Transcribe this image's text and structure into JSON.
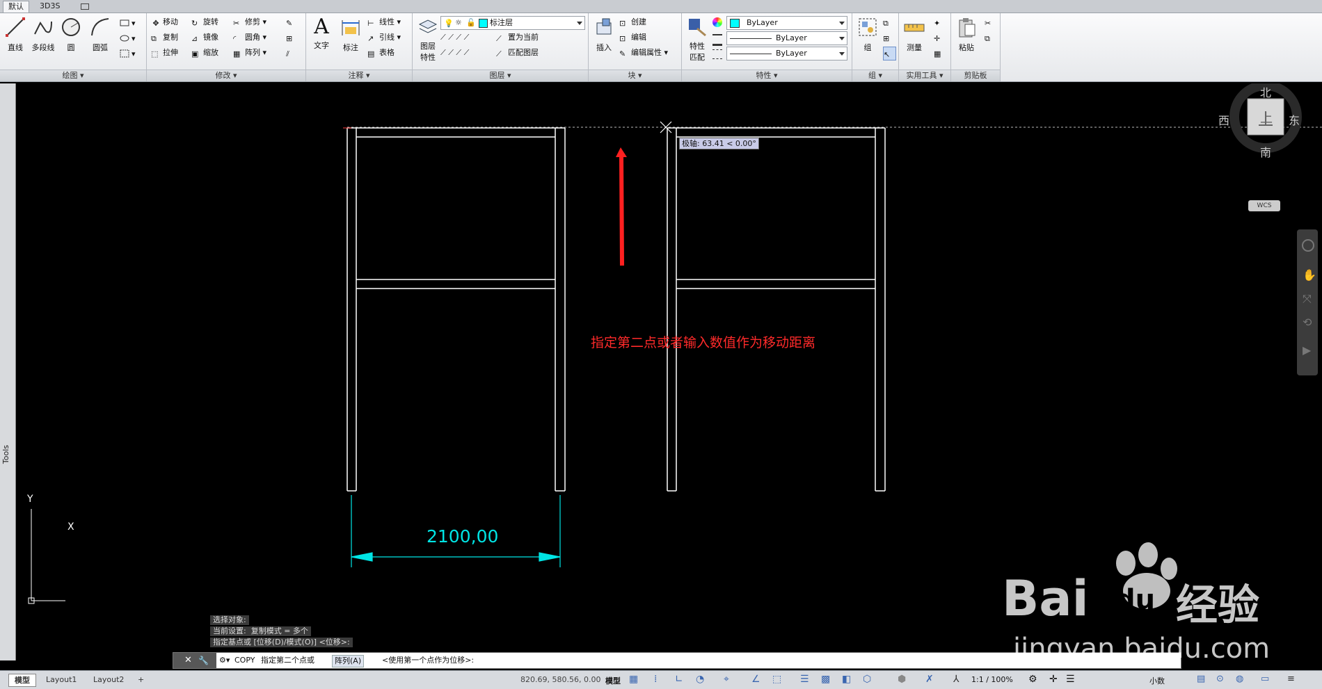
{
  "tabs": [
    "默认",
    "3D3S"
  ],
  "panels": {
    "draw": {
      "title": "绘图",
      "line": "直线",
      "polyline": "多段线",
      "circle": "圆",
      "arc": "圆弧"
    },
    "modify": {
      "title": "修改",
      "move": "移动",
      "copy": "复制",
      "stretch": "拉伸",
      "rotate": "旋转",
      "mirror": "镜像",
      "scale": "缩放",
      "trim": "修剪",
      "fillet": "圆角",
      "array": "阵列"
    },
    "annotation": {
      "title": "注释",
      "text": "文字",
      "dimension": "标注",
      "linear": "线性",
      "leader": "引线",
      "table": "表格"
    },
    "layers": {
      "title": "图层",
      "props": "图层\n特性",
      "props_l1": "图层",
      "props_l2": "特性",
      "layer_name": "标注层",
      "set_current": "置为当前",
      "match_layer": "匹配图层"
    },
    "block": {
      "title": "块",
      "insert": "插入",
      "create": "创建",
      "edit": "编辑",
      "edit_attr": "编辑属性"
    },
    "properties": {
      "title": "特性",
      "match_l1": "特性",
      "match_l2": "匹配",
      "color": "ByLayer",
      "linetype": "ByLayer",
      "lineweight": "ByLayer"
    },
    "group": {
      "title": "组",
      "group": "组"
    },
    "utilities": {
      "title": "实用工具",
      "measure": "测量"
    },
    "clipboard": {
      "title": "剪贴板",
      "paste": "粘贴"
    }
  },
  "left_strip": {
    "label": "Tools"
  },
  "tooltip": {
    "text": "极轴: 63.41 < 0.00°"
  },
  "annotation_text": "指定第二点或者输入数值作为移动距离",
  "dimension_value": "2100,00",
  "compass": {
    "north": "北",
    "south": "南",
    "east": "东",
    "west": "西",
    "top": "上",
    "wcs": "WCS"
  },
  "ucs": {
    "x": "X",
    "y": "Y"
  },
  "command_history": [
    "选择对象:",
    "当前设置:  复制模式 = 多个",
    "指定基点或 [位移(D)/模式(O)] <位移>:"
  ],
  "command_line": {
    "command": "COPY",
    "prompt": "指定第二个点或",
    "option": "阵列(A)",
    "default": "<使用第一个点作为位移>:"
  },
  "status": {
    "tabs": [
      "模型",
      "Layout1",
      "Layout2"
    ],
    "coords": "820.69, 580.56, 0.00",
    "model": "模型",
    "scale": "1:1 / 100%",
    "units": "小数"
  },
  "watermark": {
    "brand": "Bai",
    "brand2": "du",
    "cn": "经验",
    "url": "jingyan.baidu.com"
  },
  "colors": {
    "drawing_lines": "#ffffff",
    "dimension": "#00e5e5",
    "arrow_red": "#ff2020",
    "annotation_red": "#ff2a2a",
    "layer_swatch": "#00ffff"
  }
}
